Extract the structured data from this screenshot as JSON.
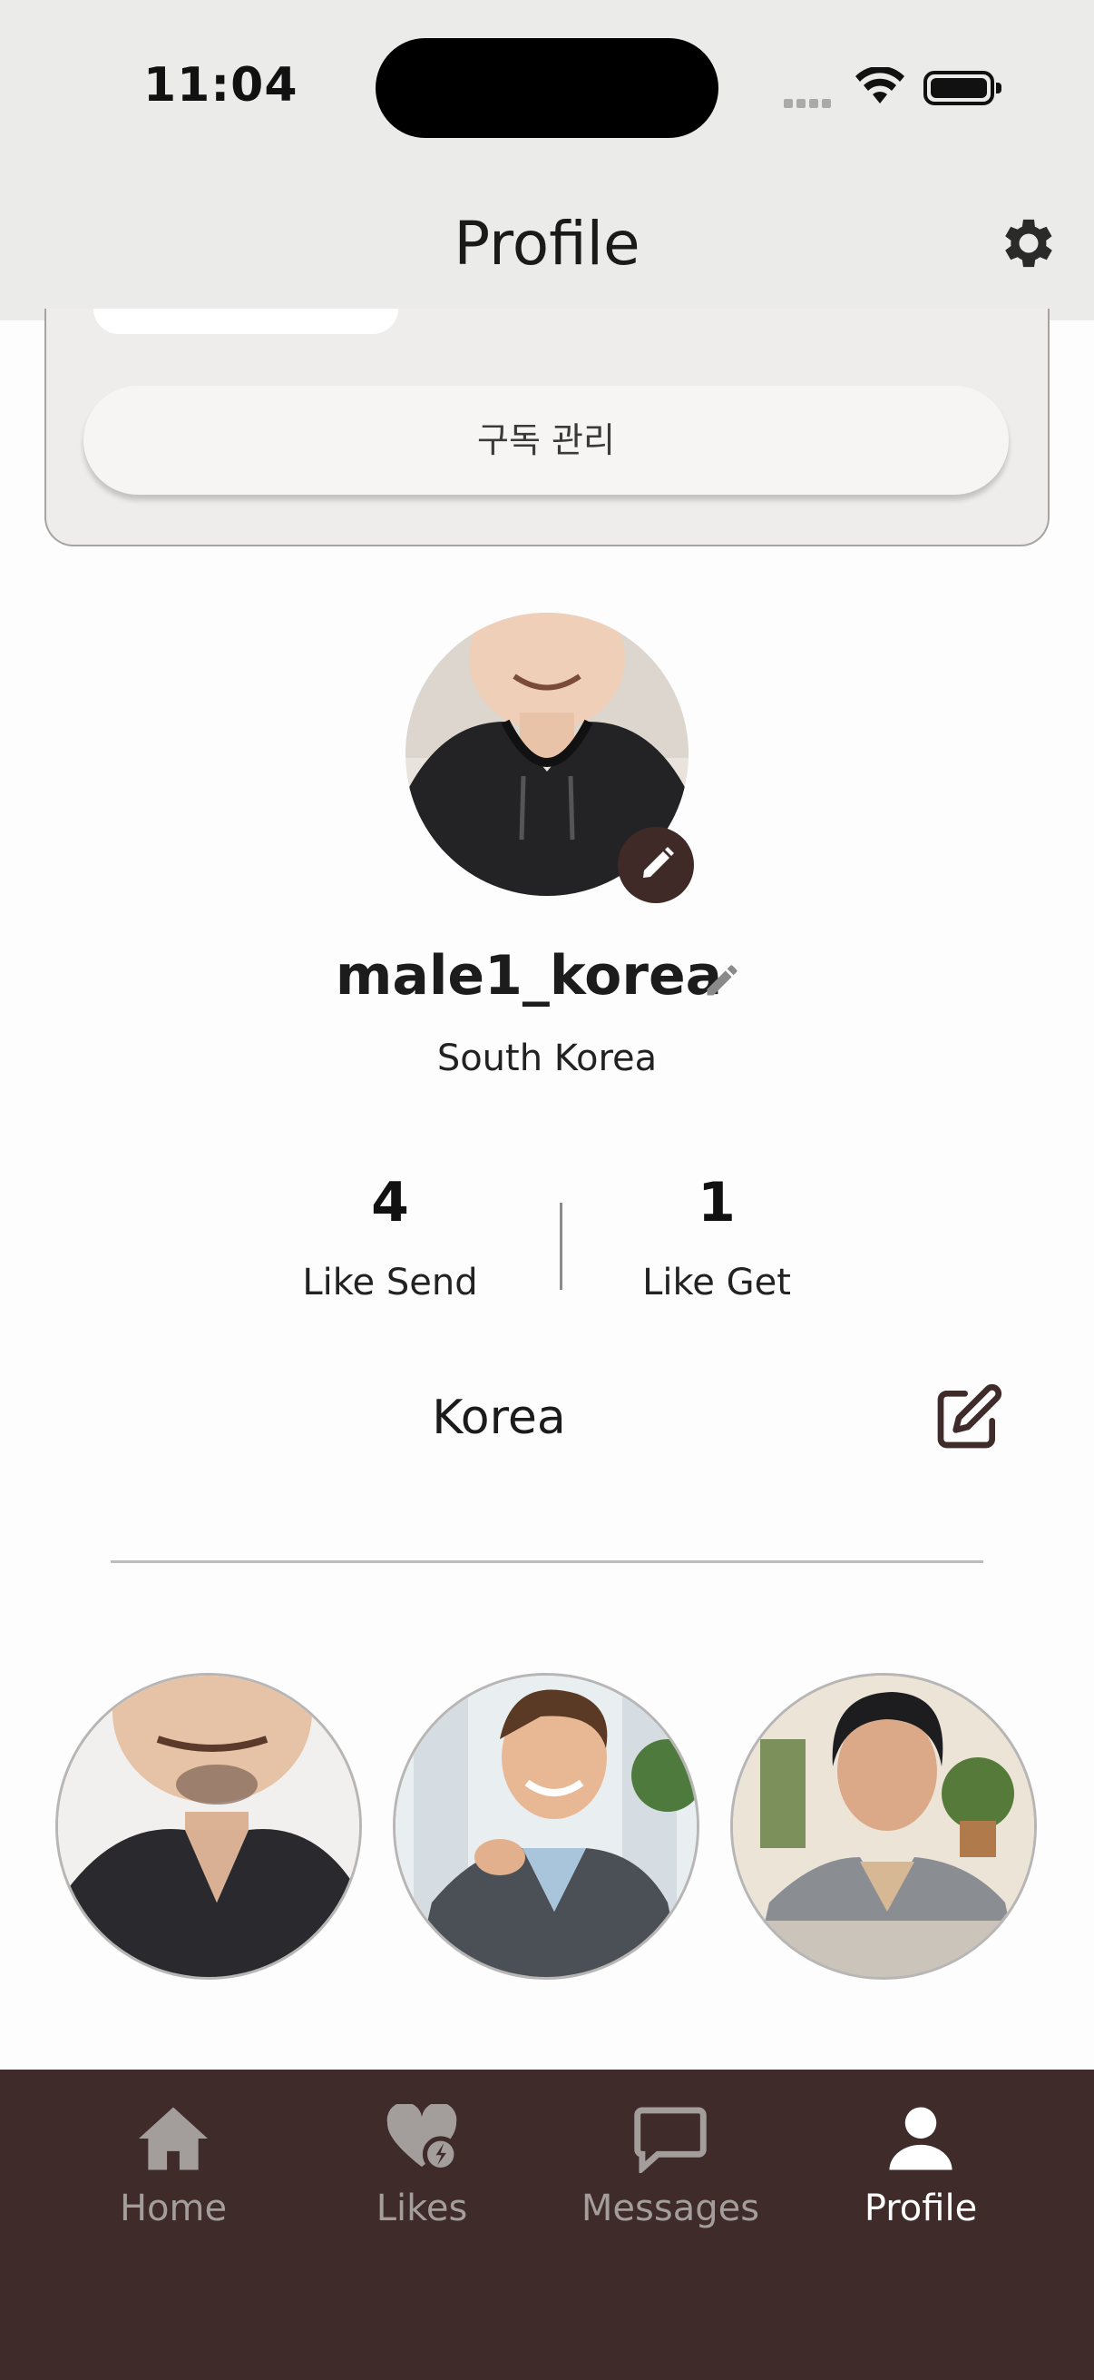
{
  "status_bar": {
    "time": "11:04"
  },
  "header": {
    "title": "Profile",
    "settings_icon": "gear-icon"
  },
  "subscription": {
    "manage_label": "구독 관리"
  },
  "profile": {
    "username": "male1_korea",
    "country": "South Korea",
    "stats": [
      {
        "value": "4",
        "label": "Like Send"
      },
      {
        "value": "1",
        "label": "Like Get"
      }
    ],
    "bio": "Korea"
  },
  "photos": [
    "photo-1",
    "photo-2",
    "photo-3"
  ],
  "tabs": [
    {
      "label": "Home",
      "icon": "home-icon",
      "active": false
    },
    {
      "label": "Likes",
      "icon": "heart-bolt-icon",
      "active": false
    },
    {
      "label": "Messages",
      "icon": "message-icon",
      "active": false
    },
    {
      "label": "Profile",
      "icon": "person-icon",
      "active": true
    }
  ],
  "colors": {
    "accent": "#3f2b29",
    "header_bg": "#ebebe9",
    "inactive_tab": "#a39e9c"
  }
}
